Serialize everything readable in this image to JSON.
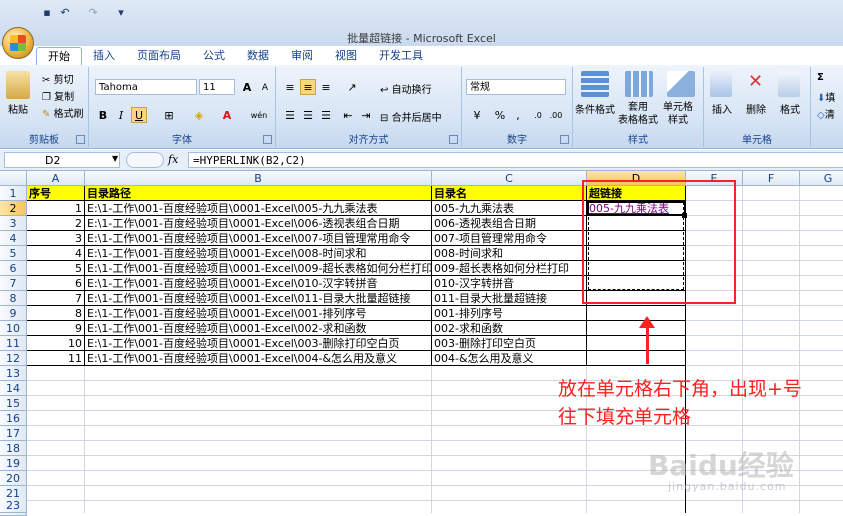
{
  "window": {
    "title": "批量超链接 - Microsoft Excel"
  },
  "quick_access": {
    "undo": "↶",
    "redo": "↷",
    "customize": "▾"
  },
  "tabs": [
    "开始",
    "插入",
    "页面布局",
    "公式",
    "数据",
    "审阅",
    "视图",
    "开发工具"
  ],
  "ribbon": {
    "clipboard": {
      "label": "剪贴板",
      "paste": "粘贴",
      "cut": "剪切",
      "copy": "复制",
      "format_painter": "格式刷"
    },
    "font": {
      "label": "字体",
      "name": "Tahoma",
      "size": "11",
      "bold": "B",
      "italic": "I",
      "underline": "U",
      "grow": "A",
      "shrink": "A",
      "wen": "wén"
    },
    "alignment": {
      "label": "对齐方式",
      "wrap_text": "自动换行",
      "merge_center": "合并后居中"
    },
    "number": {
      "label": "数字",
      "format": "常规",
      "percent": "%",
      "comma": ","
    },
    "styles": {
      "label": "样式",
      "conditional": "条件格式",
      "format_table": "套用\n表格格式",
      "cell_styles": "单元格\n样式"
    },
    "cells": {
      "label": "单元格",
      "insert": "插入",
      "delete": "删除",
      "format": "格式"
    },
    "editing": {
      "sum": "Σ",
      "fill": "填",
      "clear": "清"
    }
  },
  "formula_bar": {
    "name_box": "D2",
    "fx": "fx",
    "formula": "=HYPERLINK(B2,C2)"
  },
  "grid": {
    "columns": [
      "A",
      "B",
      "C",
      "D",
      "E",
      "F",
      "G"
    ],
    "rows": [
      "1",
      "2",
      "3",
      "4",
      "5",
      "6",
      "7",
      "8",
      "9",
      "10",
      "11",
      "12",
      "13",
      "14",
      "15",
      "16",
      "17",
      "18",
      "19",
      "20",
      "21",
      "22",
      "23"
    ],
    "header": [
      "序号",
      "目录路径",
      "目录名",
      "超链接"
    ],
    "data": [
      [
        "1",
        "E:\\1-工作\\001-百度经验项目\\0001-Excel\\005-九九乘法表",
        "005-九九乘法表",
        "005-九九乘法表"
      ],
      [
        "2",
        "E:\\1-工作\\001-百度经验项目\\0001-Excel\\006-透视表组合日期",
        "006-透视表组合日期",
        ""
      ],
      [
        "3",
        "E:\\1-工作\\001-百度经验项目\\0001-Excel\\007-项目管理常用命令",
        "007-项目管理常用命令",
        ""
      ],
      [
        "4",
        "E:\\1-工作\\001-百度经验项目\\0001-Excel\\008-时间求和",
        "008-时间求和",
        ""
      ],
      [
        "5",
        "E:\\1-工作\\001-百度经验项目\\0001-Excel\\009-超长表格如何分栏打印",
        "009-超长表格如何分栏打印",
        ""
      ],
      [
        "6",
        "E:\\1-工作\\001-百度经验项目\\0001-Excel\\010-汉字转拼音",
        "010-汉字转拼音",
        ""
      ],
      [
        "7",
        "E:\\1-工作\\001-百度经验项目\\0001-Excel\\011-目录大批量超链接",
        "011-目录大批量超链接",
        ""
      ],
      [
        "8",
        "E:\\1-工作\\001-百度经验项目\\0001-Excel\\001-排列序号",
        "001-排列序号",
        ""
      ],
      [
        "9",
        "E:\\1-工作\\001-百度经验项目\\0001-Excel\\002-求和函数",
        "002-求和函数",
        ""
      ],
      [
        "10",
        "E:\\1-工作\\001-百度经验项目\\0001-Excel\\003-删除打印空白页",
        "003-删除打印空白页",
        ""
      ],
      [
        "11",
        "E:\\1-工作\\001-百度经验项目\\0001-Excel\\004-&怎么用及意义",
        "004-&怎么用及意义",
        ""
      ]
    ]
  },
  "annotation": {
    "line1": "放在单元格右下角，出现+号",
    "line2": "往下填充单元格"
  },
  "watermark": {
    "text": "Baidu经验",
    "sub": "jingyan.baidu.com"
  },
  "colors": {
    "header_fill": "#ffff00",
    "annotation": "#ff2020",
    "link": "#800080"
  }
}
